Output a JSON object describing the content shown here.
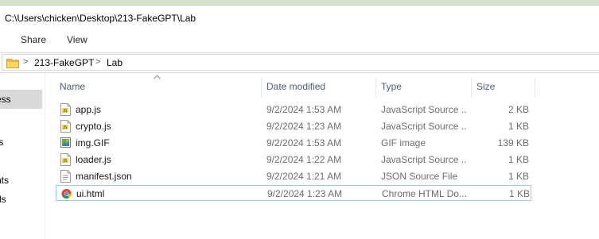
{
  "window": {
    "title": "C:\\Users\\chicken\\Desktop\\213-FakeGPT\\Lab"
  },
  "ribbon": {
    "tabs": [
      "Share",
      "View"
    ]
  },
  "address": {
    "separator": ">",
    "crumbs": [
      "213-FakeGPT",
      "Lab"
    ]
  },
  "nav": {
    "items": [
      "ess",
      "",
      "ts",
      "",
      "nts",
      "ds"
    ]
  },
  "columns": {
    "name": "Name",
    "date": "Date modified",
    "type": "Type",
    "size": "Size"
  },
  "files": [
    {
      "name": "app.js",
      "date": "9/2/2024 1:53 AM",
      "type": "JavaScript Source ...",
      "size": "2 KB",
      "icon": "js-file-icon"
    },
    {
      "name": "crypto.js",
      "date": "9/2/2024 1:23 AM",
      "type": "JavaScript Source ...",
      "size": "1 KB",
      "icon": "js-file-icon"
    },
    {
      "name": "img.GIF",
      "date": "9/2/2024 1:53 AM",
      "type": "GIF image",
      "size": "139 KB",
      "icon": "gif-image-icon"
    },
    {
      "name": "loader.js",
      "date": "9/2/2024 1:22 AM",
      "type": "JavaScript Source ...",
      "size": "1 KB",
      "icon": "js-file-icon"
    },
    {
      "name": "manifest.json",
      "date": "9/2/2024 1:21 AM",
      "type": "JSON Source File",
      "size": "1 KB",
      "icon": "json-file-icon"
    },
    {
      "name": "ui.html",
      "date": "9/2/2024 1:23 AM",
      "type": "Chrome HTML Do...",
      "size": "1 KB",
      "icon": "chrome-html-icon"
    }
  ],
  "colors": {
    "selection_border": "#99c9ef",
    "header_text": "#4c607a",
    "nav_selected": "#d9d9d9"
  }
}
